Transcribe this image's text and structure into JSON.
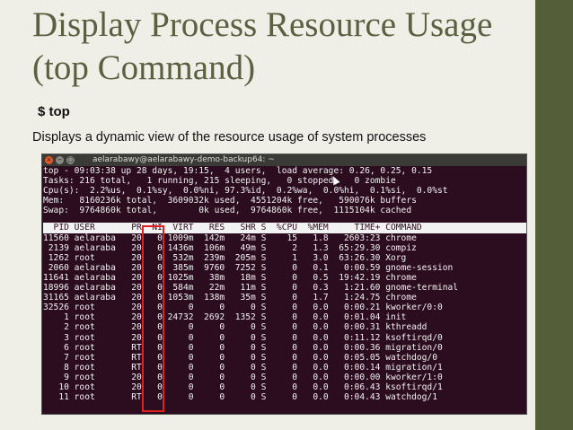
{
  "slide": {
    "title": "Display Process Resource Usage (top Command)",
    "command": "$ top",
    "description": "Displays a dynamic view of the resource usage of system processes",
    "accent_color": "#545e38",
    "title_color": "#5b6140"
  },
  "terminal": {
    "window_title": "aelarabawy@aelarabawy-demo-backup64: ~",
    "background_color": "#2c0d1f",
    "highlight_color": "#e02020",
    "summary_lines": [
      "top - 09:03:38 up 28 days, 19:15,  4 users,  load average: 0.26, 0.25, 0.15",
      "Tasks: 216 total,   1 running, 215 sleeping,   0 stopped,   0 zombie",
      "Cpu(s):  2.2%us,  0.1%sy,  0.0%ni, 97.3%id,  0.2%wa,  0.0%hi,  0.1%si,  0.0%st",
      "Mem:   8160236k total,  3609032k used,  4551204k free,   590076k buffers",
      "Swap:  9764860k total,        0k used,  9764860k free,  1115104k cached"
    ],
    "columns": [
      "PID",
      "USER",
      "PR",
      "NI",
      "VIRT",
      "RES",
      "SHR",
      "S",
      "%CPU",
      "%MEM",
      "TIME+",
      "COMMAND"
    ],
    "processes": [
      [
        "11560",
        "aelaraba",
        "20",
        "0",
        "1009m",
        "142m",
        "24m",
        "S",
        "15",
        "1.8",
        "2603:23",
        "chrome"
      ],
      [
        "2139",
        "aelaraba",
        "20",
        "0",
        "1436m",
        "106m",
        "49m",
        "S",
        "2",
        "1.3",
        "65:29.30",
        "compiz"
      ],
      [
        "1262",
        "root",
        "20",
        "0",
        "532m",
        "239m",
        "205m",
        "S",
        "1",
        "3.0",
        "63:26.30",
        "Xorg"
      ],
      [
        "2060",
        "aelaraba",
        "20",
        "0",
        "385m",
        "9760",
        "7252",
        "S",
        "0",
        "0.1",
        "0:00.59",
        "gnome-session"
      ],
      [
        "11641",
        "aelaraba",
        "20",
        "0",
        "1025m",
        "38m",
        "18m",
        "S",
        "0",
        "0.5",
        "19:42.19",
        "chrome"
      ],
      [
        "18996",
        "aelaraba",
        "20",
        "0",
        "584m",
        "22m",
        "11m",
        "S",
        "0",
        "0.3",
        "1:21.60",
        "gnome-terminal"
      ],
      [
        "31165",
        "aelaraba",
        "20",
        "0",
        "1053m",
        "138m",
        "35m",
        "S",
        "0",
        "1.7",
        "1:24.75",
        "chrome"
      ],
      [
        "32526",
        "root",
        "20",
        "0",
        "0",
        "0",
        "0",
        "S",
        "0",
        "0.0",
        "0:00.21",
        "kworker/0:0"
      ],
      [
        "1",
        "root",
        "20",
        "0",
        "24732",
        "2692",
        "1352",
        "S",
        "0",
        "0.0",
        "0:01.04",
        "init"
      ],
      [
        "2",
        "root",
        "20",
        "0",
        "0",
        "0",
        "0",
        "S",
        "0",
        "0.0",
        "0:00.31",
        "kthreadd"
      ],
      [
        "3",
        "root",
        "20",
        "0",
        "0",
        "0",
        "0",
        "S",
        "0",
        "0.0",
        "0:11.12",
        "ksoftirqd/0"
      ],
      [
        "6",
        "root",
        "RT",
        "0",
        "0",
        "0",
        "0",
        "S",
        "0",
        "0.0",
        "0:00.36",
        "migration/0"
      ],
      [
        "7",
        "root",
        "RT",
        "0",
        "0",
        "0",
        "0",
        "S",
        "0",
        "0.0",
        "0:05.05",
        "watchdog/0"
      ],
      [
        "8",
        "root",
        "RT",
        "0",
        "0",
        "0",
        "0",
        "S",
        "0",
        "0.0",
        "0:00.14",
        "migration/1"
      ],
      [
        "9",
        "root",
        "20",
        "0",
        "0",
        "0",
        "0",
        "S",
        "0",
        "0.0",
        "0:00.00",
        "kworker/1:0"
      ],
      [
        "10",
        "root",
        "20",
        "0",
        "0",
        "0",
        "0",
        "S",
        "0",
        "0.0",
        "0:06.43",
        "ksoftirqd/1"
      ],
      [
        "11",
        "root",
        "RT",
        "0",
        "0",
        "0",
        "0",
        "S",
        "0",
        "0.0",
        "0:04.43",
        "watchdog/1"
      ]
    ]
  }
}
